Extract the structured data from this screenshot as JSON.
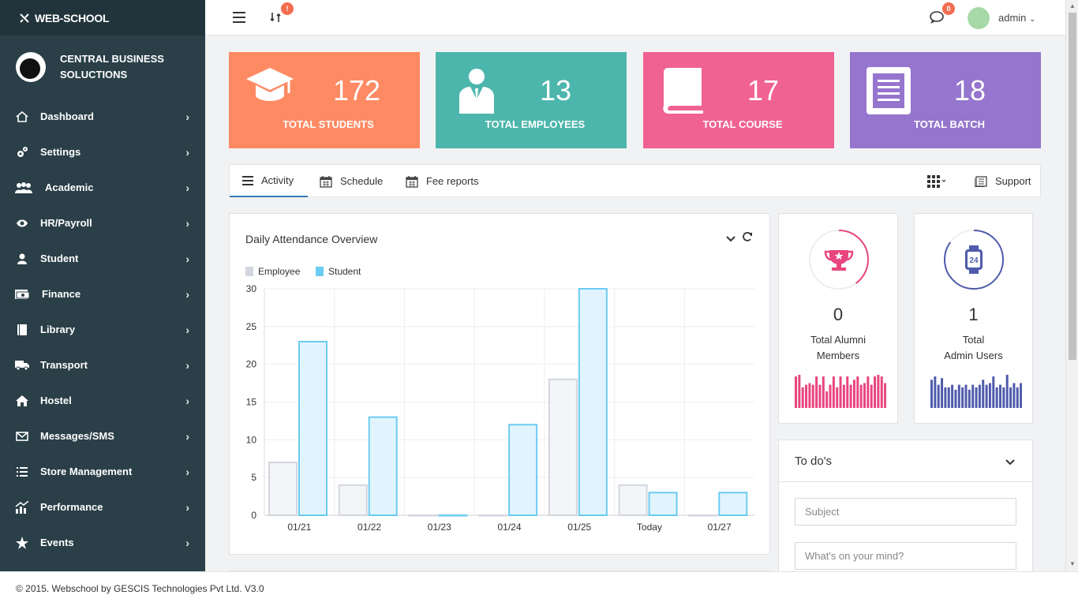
{
  "brand": {
    "title": "WEB-SCHOOL"
  },
  "org": {
    "line1": "CENTRAL BUSINESS",
    "line2": "SOLUCTIONS"
  },
  "sidebar": {
    "items": [
      {
        "label": "Dashboard",
        "icon": "home-icon"
      },
      {
        "label": "Settings",
        "icon": "gears-icon"
      },
      {
        "label": "Academic",
        "icon": "users-icon"
      },
      {
        "label": "HR/Payroll",
        "icon": "eye-icon"
      },
      {
        "label": "Student",
        "icon": "user-icon"
      },
      {
        "label": "Finance",
        "icon": "money-icon"
      },
      {
        "label": "Library",
        "icon": "book-icon"
      },
      {
        "label": "Transport",
        "icon": "truck-icon"
      },
      {
        "label": "Hostel",
        "icon": "house-icon"
      },
      {
        "label": "Messages/SMS",
        "icon": "envelope-icon"
      },
      {
        "label": "Store Management",
        "icon": "list-icon"
      },
      {
        "label": "Performance",
        "icon": "chart-icon"
      },
      {
        "label": "Events",
        "icon": "star-icon"
      }
    ]
  },
  "topbar": {
    "notif_badge": "!",
    "msg_badge": "0",
    "user": "admin"
  },
  "stats": [
    {
      "value": "172",
      "label": "TOTAL STUDENTS",
      "color": "#fe8a63"
    },
    {
      "value": "13",
      "label": "TOTAL EMPLOYEES",
      "color": "#4db6ac"
    },
    {
      "value": "17",
      "label": "TOTAL COURSE",
      "color": "#f06292"
    },
    {
      "value": "18",
      "label": "TOTAL BATCH",
      "color": "#9575cd"
    }
  ],
  "tabs": {
    "activity": "Activity",
    "schedule": "Schedule",
    "fee": "Fee reports",
    "support": "Support"
  },
  "attendance": {
    "title": "Daily Attendance Overview"
  },
  "chart_data": {
    "type": "bar",
    "categories": [
      "01/21",
      "01/22",
      "01/23",
      "01/24",
      "01/25",
      "Today",
      "01/27"
    ],
    "series": [
      {
        "name": "Employee",
        "values": [
          7,
          4,
          0,
          0,
          18,
          4,
          0
        ],
        "color": "#d2d6de"
      },
      {
        "name": "Student",
        "values": [
          23,
          13,
          0,
          12,
          30,
          3,
          3
        ],
        "color": "#6ccbf2"
      }
    ],
    "ylim": [
      0,
      30
    ],
    "yticks": [
      0,
      5,
      10,
      15,
      20,
      25,
      30
    ],
    "grid": true,
    "legend": "top-left"
  },
  "alumni": {
    "value": "0",
    "line1": "Total Alumni",
    "line2": "Members",
    "color": "#e8457f",
    "progress": 0.6,
    "bars": [
      0.95,
      1,
      0.62,
      0.7,
      0.75,
      0.7,
      0.95,
      0.7,
      0.95,
      0.5,
      0.7,
      0.95,
      0.62,
      0.95,
      0.7,
      0.95,
      0.7,
      0.85,
      0.95,
      0.7,
      0.75,
      0.95,
      0.7,
      0.95,
      1,
      0.95,
      0.75
    ]
  },
  "admins": {
    "value": "1",
    "line1": "Total",
    "line2": "Admin Users",
    "color": "#4f5bab",
    "progress": 0.15,
    "bars": [
      0.85,
      0.95,
      0.7,
      0.9,
      0.62,
      0.62,
      0.7,
      0.55,
      0.7,
      0.62,
      0.7,
      0.55,
      0.7,
      0.62,
      0.7,
      0.85,
      0.7,
      0.75,
      0.95,
      0.62,
      0.7,
      0.62,
      1,
      0.62,
      0.75,
      0.62,
      0.75
    ]
  },
  "todo": {
    "title": "To do's",
    "subject_placeholder": "Subject",
    "mind_placeholder": "What's on your mind?"
  },
  "footer": {
    "text": "© 2015. Webschool by GESCIS Technologies Pvt Ltd. V3.0"
  }
}
